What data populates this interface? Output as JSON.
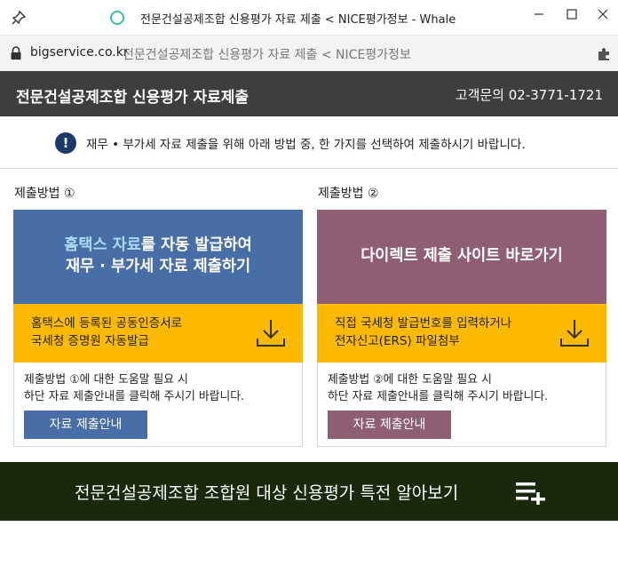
{
  "window": {
    "title": "전문건설공제조합 신용평가 자료 제출 < NICE평가정보 - Whale"
  },
  "address": {
    "domain": "bigservice.co.kr",
    "page_title": "전문건설공제조합 신용평가 자료 제출 < NICE평가정보"
  },
  "header": {
    "title": "전문건설공제조합 신용평가 자료제출",
    "contact": "고객문의  02-3771-1721"
  },
  "notice": {
    "text": "재무 • 부가세 자료 제출을 위해 아래 방법 중, 한 가지를 선택하여 제출하시기 바랍니다."
  },
  "methods": [
    {
      "label": "제출방법 ①",
      "title_highlight": "홈택스 자료",
      "title_rest_line1": "를 자동 발급하여",
      "title_line2": "재무 · 부가세 자료 제출하기",
      "desc_line1": "홈택스에 등록된 공동인증서로",
      "desc_line2": "국세청 증명원 자동발급",
      "help_line1": "제출방법 ①에 대한 도움말 필요 시",
      "help_line2": "하단 자료 제출안내를 클릭해 주시기 바랍니다.",
      "button": "자료 제출안내"
    },
    {
      "label": "제출방법 ②",
      "title_line1": "다이렉트 제출 사이트 바로가기",
      "desc_line1": "직접 국세청 발급번호를 입력하거나",
      "desc_line2": "전자신고(ERS) 파일첨부",
      "help_line1": "제출방법 ②에 대한 도움말 필요 시",
      "help_line2": "하단 자료 제출안내를 클릭해 주시기 바랍니다.",
      "button": "자료 제출안내"
    }
  ],
  "banner": {
    "text": "전문건설공제조합 조합원 대상 신용평가 특전 알아보기"
  },
  "colors": {
    "header_bg": "#3e3e40",
    "method1": "#476ea7",
    "method2": "#905e73",
    "accent_yellow": "#fbb900",
    "banner_bg": "#18290c",
    "highlight": "#a9ddf7"
  },
  "icons": [
    "pin-icon",
    "loading-icon",
    "minimize-icon",
    "maximize-icon",
    "close-icon",
    "lock-icon",
    "extension-icon",
    "info-icon",
    "download-icon",
    "list-plus-icon"
  ]
}
